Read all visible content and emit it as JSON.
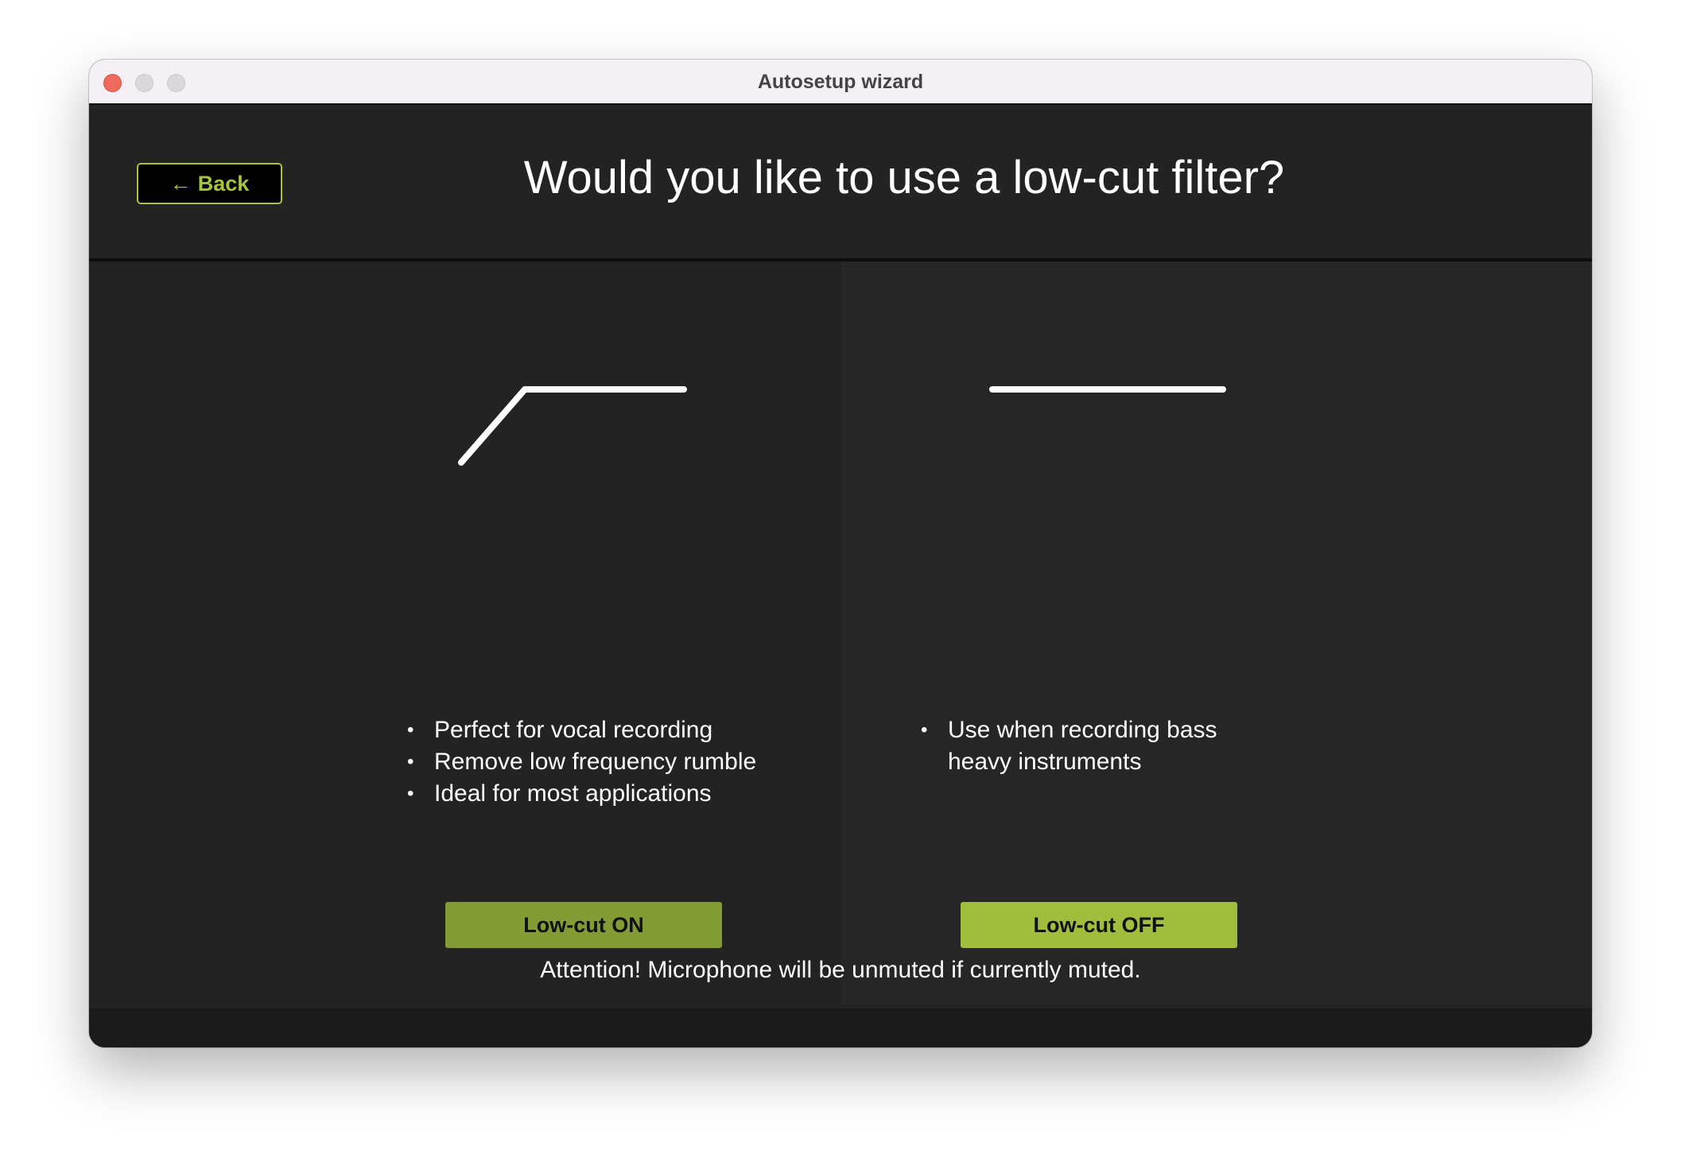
{
  "window": {
    "title": "Autosetup wizard"
  },
  "header": {
    "back_label": "Back",
    "back_icon": "left-arrow-icon",
    "question": "Would you like to use a low-cut filter?"
  },
  "options": {
    "low_cut_on": {
      "graph_icon": "low-cut-curve-icon",
      "bullets": [
        "Perfect for vocal recording",
        "Remove low frequency rumble",
        "Ideal for most applications"
      ],
      "button_label": "Low-cut ON"
    },
    "low_cut_off": {
      "graph_icon": "flat-response-icon",
      "bullets": [
        "Use when recording bass heavy instruments"
      ],
      "button_label": "Low-cut OFF"
    }
  },
  "footer": {
    "attention": "Attention! Microphone will be unmuted if currently muted."
  },
  "colors": {
    "accent": "#a6c43c",
    "button_on": "#839b35",
    "button_off": "#a1bd3e",
    "background": "#242424"
  }
}
